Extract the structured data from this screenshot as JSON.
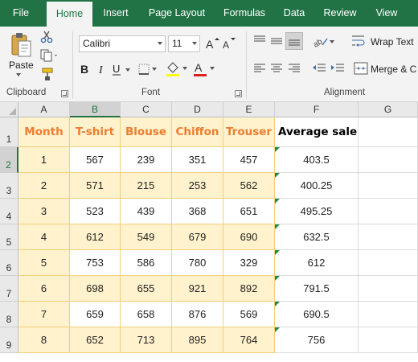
{
  "ribbon_tabs": [
    {
      "label": "File"
    },
    {
      "label": "Home"
    },
    {
      "label": "Insert"
    },
    {
      "label": "Page Layout"
    },
    {
      "label": "Formulas"
    },
    {
      "label": "Data"
    },
    {
      "label": "Review"
    },
    {
      "label": "View"
    }
  ],
  "active_tab": "Home",
  "clipboard": {
    "paste_label": "Paste",
    "group_label": "Clipboard"
  },
  "font": {
    "name": "Calibri",
    "size": "11",
    "group_label": "Font"
  },
  "alignment": {
    "wrap_text_label": "Wrap Text",
    "merge_label": "Merge & C",
    "group_label": "Alignment"
  },
  "colors": {
    "excel_green": "#217346",
    "header_orange": "#ed7d31",
    "band_yellow": "#fff2cc",
    "band_border": "#f2cf7a",
    "font_color_bar": "#e02020"
  },
  "grid": {
    "columns": [
      "A",
      "B",
      "C",
      "D",
      "E",
      "F",
      "G"
    ],
    "selected_column": "B",
    "rows": [
      "1",
      "2",
      "3",
      "4",
      "5",
      "6",
      "7",
      "8",
      "9"
    ],
    "selected_row": "2",
    "header_row": [
      "Month",
      "T-shirt",
      "Blouse",
      "Chiffon",
      "Trouser",
      "Average sale"
    ],
    "data_rows": [
      [
        "1",
        "567",
        "239",
        "351",
        "457",
        "403.5"
      ],
      [
        "2",
        "571",
        "215",
        "253",
        "562",
        "400.25"
      ],
      [
        "3",
        "523",
        "439",
        "368",
        "651",
        "495.25"
      ],
      [
        "4",
        "612",
        "549",
        "679",
        "690",
        "632.5"
      ],
      [
        "5",
        "753",
        "586",
        "780",
        "329",
        "612"
      ],
      [
        "6",
        "698",
        "655",
        "921",
        "892",
        "791.5"
      ],
      [
        "7",
        "659",
        "658",
        "876",
        "569",
        "690.5"
      ],
      [
        "8",
        "652",
        "713",
        "895",
        "764",
        "756"
      ]
    ]
  }
}
